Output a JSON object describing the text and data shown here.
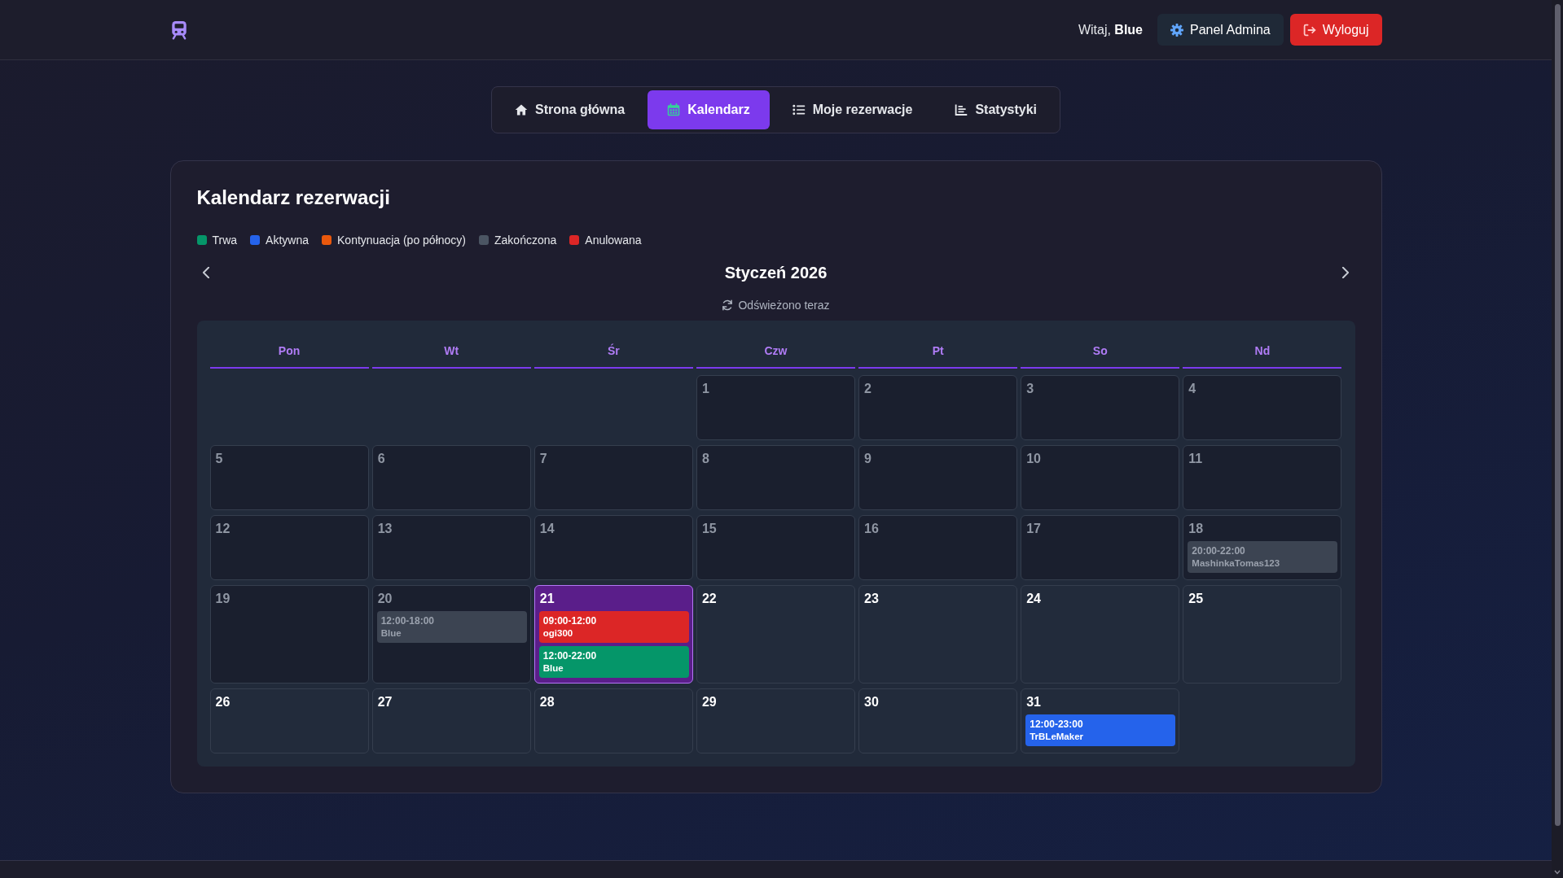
{
  "header": {
    "greeting": "Witaj, **Blue**",
    "buttons": [
      {
        "label": "Panel Admina",
        "kind": "secondary"
      },
      {
        "label": "Wyloguj",
        "kind": "danger"
      }
    ]
  },
  "tabs": [
    {
      "label": "Strona główna",
      "selected": false
    },
    {
      "label": "Kalendarz",
      "selected": true
    },
    {
      "label": "Moje rezerwacje",
      "selected": false
    },
    {
      "label": "Statystyki",
      "selected": false
    }
  ],
  "calendar": {
    "title": "Kalendarz rezerwacji",
    "legend": [
      {
        "label": "Trwa",
        "color": "#059669"
      },
      {
        "label": "Aktywna",
        "color": "#2563eb"
      },
      {
        "label": "Kontynuacja (po północy)",
        "color": "#ea580c"
      },
      {
        "label": "Zakończona",
        "color": "#4b5563"
      },
      {
        "label": "Anulowana",
        "color": "#dc2626"
      }
    ],
    "month": "Styczeń 2026",
    "refresh_note": "Odświeżono teraz",
    "weekdays": [
      "Pon",
      "Wt",
      "Śr",
      "Czw",
      "Pt",
      "So",
      "Nd"
    ],
    "weeks": [
      [
        {
          "kind": "blank"
        },
        {
          "kind": "blank"
        },
        {
          "kind": "blank"
        },
        {
          "kind": "day",
          "date": "1",
          "past": true,
          "today": false
        },
        {
          "kind": "day",
          "date": "2",
          "past": true,
          "today": false
        },
        {
          "kind": "day",
          "date": "3",
          "past": true,
          "today": false
        },
        {
          "kind": "day",
          "date": "4",
          "past": true,
          "today": false
        }
      ],
      [
        {
          "kind": "day",
          "date": "5",
          "past": true,
          "today": false
        },
        {
          "kind": "day",
          "date": "6",
          "past": true,
          "today": false
        },
        {
          "kind": "day",
          "date": "7",
          "past": true,
          "today": false
        },
        {
          "kind": "day",
          "date": "8",
          "past": true,
          "today": false
        },
        {
          "kind": "day",
          "date": "9",
          "past": true,
          "today": false
        },
        {
          "kind": "day",
          "date": "10",
          "past": true,
          "today": false
        },
        {
          "kind": "day",
          "date": "11",
          "past": true,
          "today": false
        }
      ],
      [
        {
          "kind": "day",
          "date": "12",
          "past": true,
          "today": false
        },
        {
          "kind": "day",
          "date": "13",
          "past": true,
          "today": false
        },
        {
          "kind": "day",
          "date": "14",
          "past": true,
          "today": false
        },
        {
          "kind": "day",
          "date": "15",
          "past": true,
          "today": false
        },
        {
          "kind": "day",
          "date": "16",
          "past": true,
          "today": false
        },
        {
          "kind": "day",
          "date": "17",
          "past": true,
          "today": false
        },
        {
          "kind": "day",
          "date": "18",
          "past": true,
          "today": false,
          "events": [
            {
              "time": "20:00-22:00",
              "user": "MashinkaTomas123",
              "color": "#3c4452"
            }
          ]
        }
      ],
      [
        {
          "kind": "day",
          "date": "19",
          "past": true,
          "today": false
        },
        {
          "kind": "day",
          "date": "20",
          "past": true,
          "today": false,
          "events": [
            {
              "time": "12:00-18:00",
              "user": "Blue",
              "color": "#3c4452"
            }
          ]
        },
        {
          "kind": "day",
          "date": "21",
          "past": false,
          "today": true,
          "events": [
            {
              "time": "09:00-12:00",
              "user": "ogi300",
              "color": "#dc2626"
            },
            {
              "time": "12:00-22:00",
              "user": "Blue",
              "color": "#059669"
            }
          ]
        },
        {
          "kind": "day",
          "date": "22",
          "past": false,
          "today": false
        },
        {
          "kind": "day",
          "date": "23",
          "past": false,
          "today": false
        },
        {
          "kind": "day",
          "date": "24",
          "past": false,
          "today": false
        },
        {
          "kind": "day",
          "date": "25",
          "past": false,
          "today": false
        }
      ],
      [
        {
          "kind": "day",
          "date": "26",
          "past": false,
          "today": false
        },
        {
          "kind": "day",
          "date": "27",
          "past": false,
          "today": false
        },
        {
          "kind": "day",
          "date": "28",
          "past": false,
          "today": false
        },
        {
          "kind": "day",
          "date": "29",
          "past": false,
          "today": false
        },
        {
          "kind": "day",
          "date": "30",
          "past": false,
          "today": false
        },
        {
          "kind": "day",
          "date": "31",
          "past": false,
          "today": false,
          "events": [
            {
              "time": "12:00-23:00",
              "user": "TrBLeMaker",
              "color": "#2563eb"
            }
          ]
        },
        {
          "kind": "blank"
        }
      ]
    ]
  }
}
